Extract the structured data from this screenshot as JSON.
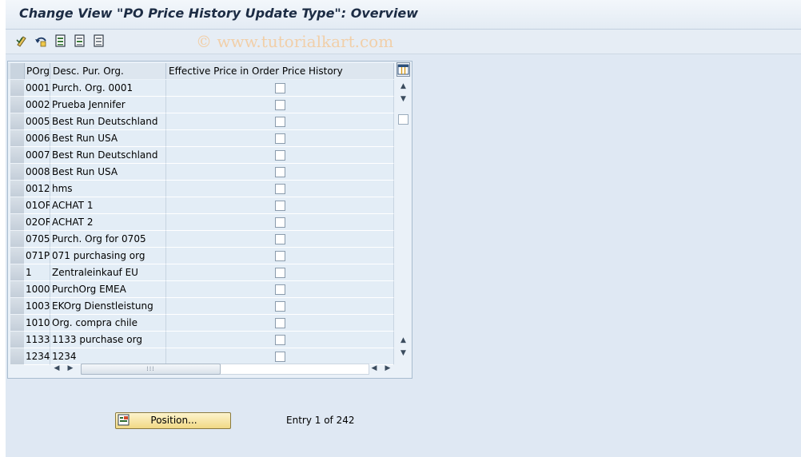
{
  "window": {
    "title": "Change View \"PO Price History Update Type\": Overview"
  },
  "toolbar": {
    "watermark": "© www.tutorialkart.com",
    "buttons": [
      "display-change-icon",
      "undo-icon",
      "select-all-icon",
      "deselect-all-icon",
      "select-block-icon"
    ]
  },
  "table": {
    "columns": [
      "POrg",
      "Desc. Pur. Org.",
      "Effective Price in Order Price History"
    ],
    "rows": [
      {
        "porg": "0001",
        "desc": "Purch. Org. 0001",
        "checked": false
      },
      {
        "porg": "0002",
        "desc": "Prueba Jennifer",
        "checked": false
      },
      {
        "porg": "0005",
        "desc": "Best Run Deutschland",
        "checked": false
      },
      {
        "porg": "0006",
        "desc": "Best Run USA",
        "checked": false
      },
      {
        "porg": "0007",
        "desc": "Best Run Deutschland",
        "checked": false
      },
      {
        "porg": "0008",
        "desc": "Best Run USA",
        "checked": false
      },
      {
        "porg": "0012",
        "desc": "hms",
        "checked": false
      },
      {
        "porg": "01OR",
        "desc": "ACHAT 1",
        "checked": false
      },
      {
        "porg": "02OR",
        "desc": "ACHAT 2",
        "checked": false
      },
      {
        "porg": "0705",
        "desc": "Purch. Org for 0705",
        "checked": false
      },
      {
        "porg": "071P",
        "desc": "071 purchasing org",
        "checked": false
      },
      {
        "porg": "1",
        "desc": "Zentraleinkauf EU",
        "checked": false
      },
      {
        "porg": "1000",
        "desc": "PurchOrg EMEA",
        "checked": false
      },
      {
        "porg": "1003",
        "desc": "EKOrg Dienstleistung",
        "checked": false
      },
      {
        "porg": "1010",
        "desc": "Org. compra chile",
        "checked": false
      },
      {
        "porg": "1133",
        "desc": "1133 purchase org",
        "checked": false
      },
      {
        "porg": "1234",
        "desc": "1234",
        "checked": false
      }
    ]
  },
  "footer": {
    "position_label": "Position...",
    "entry_text": "Entry 1 of 242"
  },
  "colors": {
    "background": "#dfe8f3",
    "row": "#e3edf6",
    "button": "#f1d985"
  }
}
